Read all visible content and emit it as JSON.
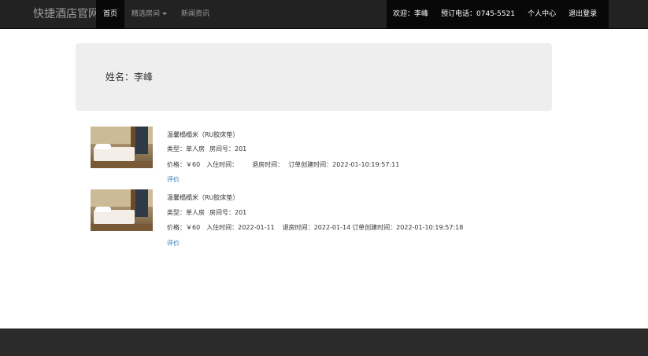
{
  "navbar": {
    "brand": "快捷酒店官网",
    "items": [
      {
        "label": "首页"
      },
      {
        "label": "精选房间"
      },
      {
        "label": "新闻资讯"
      }
    ],
    "welcome": "欢迎：李峰",
    "phone": "预订电话：0745-5521",
    "profile": "个人中心",
    "logout": "退出登录"
  },
  "jumbotron": {
    "name": "姓名：李峰"
  },
  "orders": [
    {
      "title": "温馨榻榻米（RU胶床垫）",
      "type": "类型：单人房",
      "room": "房间号：201",
      "price": "价格：￥60",
      "checkin": "入住时间：",
      "checkout": "退房时间：",
      "created": "订单创建时间：2022-01-10:19:57:11",
      "review": "评价"
    },
    {
      "title": "温馨榻榻米（RU胶床垫）",
      "type": "类型：单人房",
      "room": "房间号：201",
      "price": "价格：￥60",
      "checkin": "入住时间：2022-01-11",
      "checkout": "退房时间：2022-01-14",
      "created": "订单创建时间：2022-01-10:19:57:18",
      "review": "评价"
    }
  ]
}
